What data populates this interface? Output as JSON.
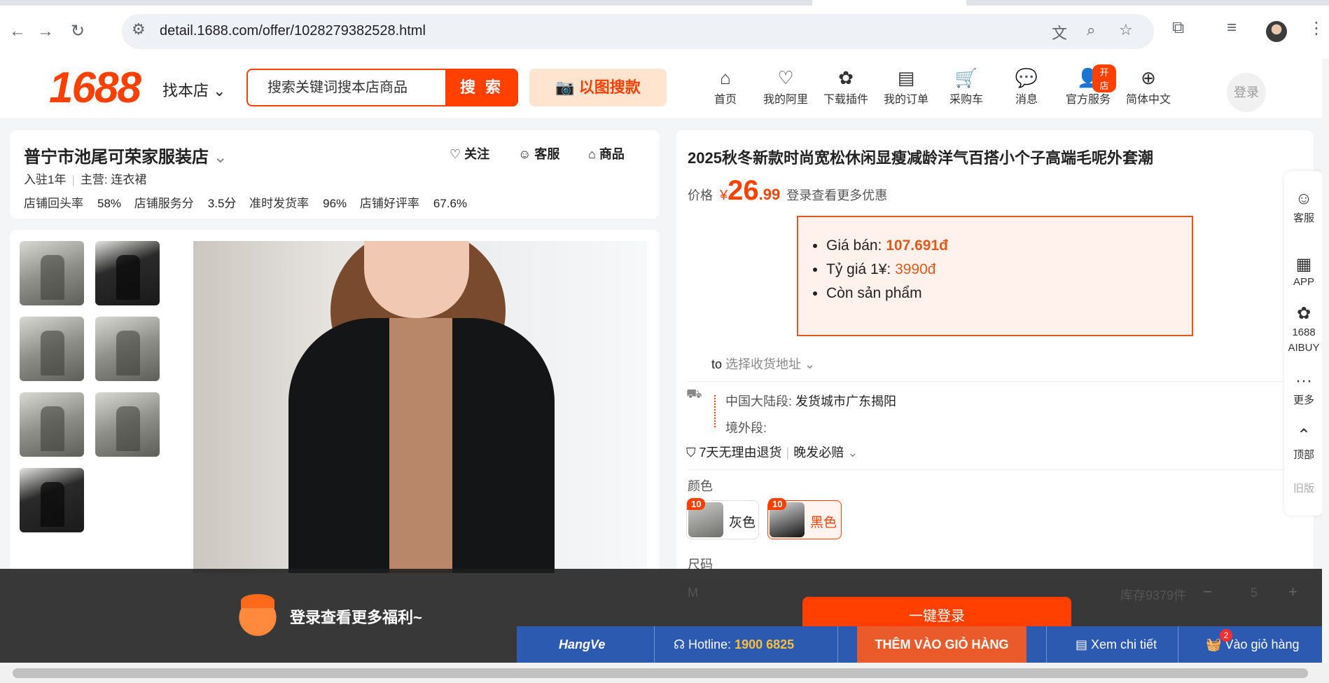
{
  "browser": {
    "url": "detail.1688.com/offer/1028279382528.html"
  },
  "header": {
    "logo": "1688",
    "find_store": "找本店",
    "search_placeholder": "搜索关键词搜本店商品",
    "search_button": "搜 索",
    "image_search": "以图搜款",
    "nav": [
      {
        "label": "首页",
        "icon": "home-icon"
      },
      {
        "label": "我的阿里",
        "icon": "heart-shield-icon"
      },
      {
        "label": "下载插件",
        "icon": "puzzle-icon"
      },
      {
        "label": "我的订单",
        "icon": "clipboard-icon"
      },
      {
        "label": "采购车",
        "icon": "cart-icon"
      },
      {
        "label": "消息",
        "icon": "message-icon"
      },
      {
        "label": "官方服务",
        "icon": "person-icon",
        "badge": "开店"
      },
      {
        "label": "简体中文",
        "icon": "globe-icon"
      }
    ],
    "login": "登录"
  },
  "store": {
    "name": "普宁市池尾可荣家服装店",
    "years": "入驻1年",
    "main_label": "主营:",
    "main_value": "连衣裙",
    "stats": [
      {
        "label": "店铺回头率",
        "value": "58%"
      },
      {
        "label": "店铺服务分",
        "value": "3.5分"
      },
      {
        "label": "准时发货率",
        "value": "96%"
      },
      {
        "label": "店铺好评率",
        "value": "67.6%"
      }
    ],
    "actions": {
      "follow": "关注",
      "service": "客服",
      "products": "商品"
    }
  },
  "product": {
    "title": "2025秋冬新款时尚宽松休闲显瘦减龄洋气百搭小个子高端毛呢外套潮",
    "price_label": "价格",
    "currency": "¥",
    "price_int": "26",
    "price_dec": ".99",
    "price_more": "登录查看更多优惠",
    "ext": {
      "sale_label": "Giá bán: ",
      "sale_value": "107.691đ",
      "rate_label": "Tỷ giá 1¥: ",
      "rate_value": "3990đ",
      "stock": "Còn sản phẩm"
    },
    "ship_to": "to",
    "ship_addr": "选择收货地址",
    "mainland_label": "中国大陆段:",
    "mainland_value": "发货城市广东揭阳",
    "overseas_label": "境外段:",
    "guarantee1": "7天无理由退货",
    "guarantee2": "晚发必赔",
    "color_label": "颜色",
    "colors": [
      {
        "name": "灰色",
        "count": "10"
      },
      {
        "name": "黑色",
        "count": "10"
      }
    ],
    "size_label": "尺码",
    "size_row": {
      "size": "M",
      "stock": "库存9379件",
      "minus": "−",
      "qty": "5",
      "plus": "+"
    }
  },
  "floatbar": [
    {
      "label": "客服",
      "icon": "service-icon"
    },
    {
      "label": "APP",
      "icon": "qr-icon"
    },
    {
      "label": "1688\nAIBUY",
      "icon": "aibuy-icon"
    },
    {
      "label": "更多",
      "icon": "more-icon"
    },
    {
      "label": "顶部",
      "icon": "chevron-up-icon"
    },
    {
      "label": "旧版",
      "icon": ""
    }
  ],
  "overlay": {
    "text": "登录查看更多福利~",
    "one_click_login": "一键登录"
  },
  "extbar": {
    "logo": "HangVe",
    "hotline_label": "Hotline: ",
    "hotline_number": "1900 6825",
    "add_to_cart": "THÊM VÀO GIỎ HÀNG",
    "view_detail": "Xem chi tiết",
    "go_cart": "Vào giỏ hàng",
    "cart_count": "2"
  }
}
